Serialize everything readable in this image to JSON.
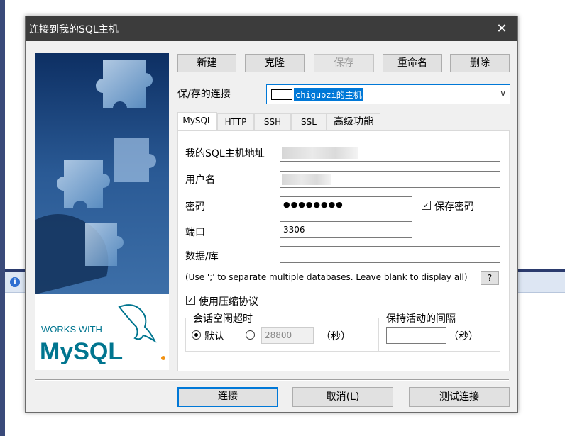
{
  "dialog": {
    "title": "连接到我的SQL主机",
    "close_glyph": "✕"
  },
  "toolbar": {
    "new": "新建",
    "clone": "克隆",
    "save": "保存",
    "rename": "重命名",
    "delete": "删除"
  },
  "saved_connection": {
    "label": "保/存的连接",
    "value": "chiguozi的主机"
  },
  "tabs": [
    {
      "label": "MySQL",
      "active": true
    },
    {
      "label": "HTTP"
    },
    {
      "label": "SSH"
    },
    {
      "label": "SSL"
    },
    {
      "label": "高级功能"
    }
  ],
  "form": {
    "host_label": "我的SQL主机地址",
    "user_label": "用户名",
    "password_label": "密码",
    "password_value": "●●●●●●●●",
    "save_password_label": "保存密码",
    "save_password_checked": true,
    "port_label": "端口",
    "port_value": "3306",
    "database_label": "数据/库",
    "database_value": "",
    "hint": "(Use ';' to separate multiple databases. Leave blank to display all)",
    "help_label": "?",
    "compression_label": "使用压缩协议",
    "compression_checked": true,
    "idle_group_title": "会话空闲超时",
    "idle_default_label": "默认",
    "idle_custom_value": "28800",
    "idle_unit": "（秒）",
    "keepalive_group_title": "保持活动的间隔",
    "keepalive_value": "",
    "keepalive_unit": "（秒）"
  },
  "footer": {
    "connect": "连接",
    "cancel": "取消(L)",
    "test": "测试连接"
  },
  "side_image": {
    "works_with": "WORKS WITH",
    "mysql": "MySQL"
  },
  "colors": {
    "accent": "#0078d7",
    "titlebar": "#3c3c3c",
    "mysql_blue": "#00758f",
    "mysql_orange": "#f29111"
  }
}
